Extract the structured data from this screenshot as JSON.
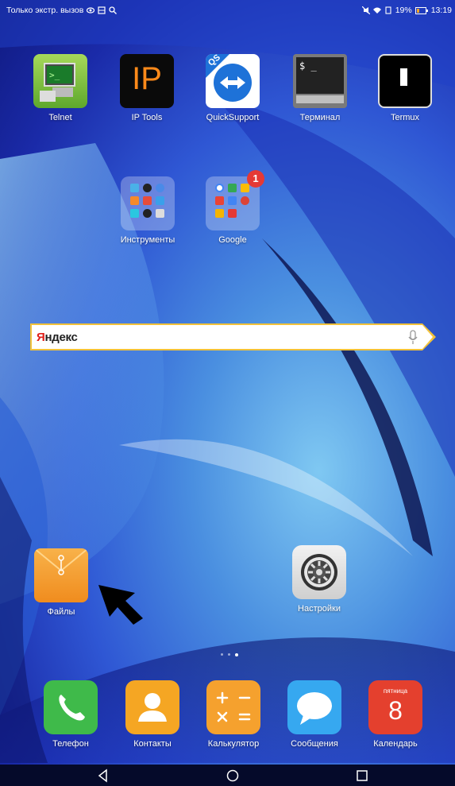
{
  "status_bar": {
    "carrier_text": "Только экстр. вызов",
    "battery_text": "19%",
    "time": "13:19"
  },
  "apps_row1": [
    {
      "name": "Telnet"
    },
    {
      "name": "IP Tools",
      "tile_text": "IP"
    },
    {
      "name": "QuickSupport",
      "tile_text": "QS"
    },
    {
      "name": "Терминал",
      "tile_text": "$ _"
    },
    {
      "name": "Termux"
    }
  ],
  "folders": [
    {
      "name": "Инструменты"
    },
    {
      "name": "Google",
      "badge": "1"
    }
  ],
  "search": {
    "logo_ya": "Я",
    "logo_rest": "ндекс"
  },
  "home_apps": [
    {
      "name": "Файлы"
    },
    {
      "name": "Настройки"
    }
  ],
  "dock": [
    {
      "name": "Телефон"
    },
    {
      "name": "Контакты"
    },
    {
      "name": "Калькулятор"
    },
    {
      "name": "Сообщения"
    },
    {
      "name": "Календарь",
      "weekday": "пятница",
      "day": "8"
    }
  ],
  "colors": {
    "search_border": "#f2c23a",
    "yandex_red": "#e0201b",
    "phone_green": "#3fba4a",
    "contacts_orange": "#f5a623",
    "files_orange": "#f5a12e",
    "messages_blue": "#36a8f0",
    "calendar_red": "#e4402e"
  }
}
